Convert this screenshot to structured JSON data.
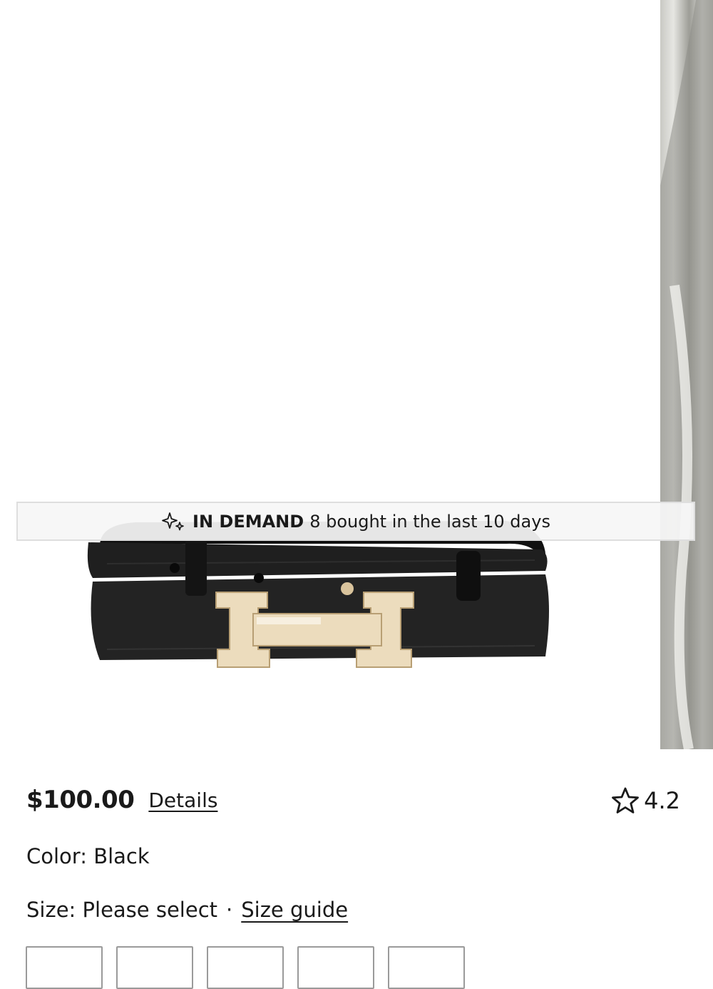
{
  "product": {
    "price": "$100.00",
    "details_label": "Details",
    "rating": "4.2",
    "color_label": "Color: Black",
    "size_label": "Size: Please select",
    "size_separator": "·",
    "size_guide_label": "Size guide"
  },
  "badge": {
    "icon": "sparkle-icon",
    "strong_text": "IN DEMAND",
    "text": "8 bought in the last 10 days"
  },
  "size_options": [
    "",
    "",
    "",
    "",
    ""
  ],
  "colors": {
    "text": "#1a1a1a",
    "banner_bg": "#f6f6f6",
    "belt_leather": "#1c1c1c",
    "buckle_gold": "#e8d6b4"
  }
}
